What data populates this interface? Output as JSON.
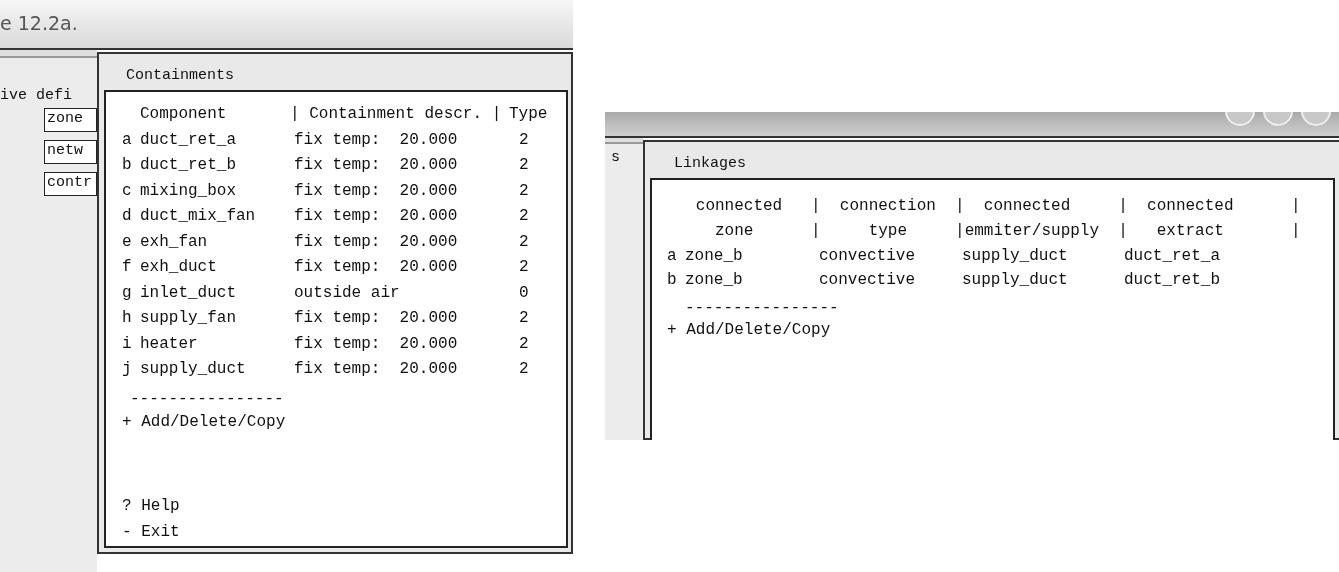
{
  "left_window": {
    "title": "e 12.2a.",
    "behind": {
      "label": "ive defi",
      "buttons": [
        "zone",
        "netw",
        "contr"
      ]
    },
    "dialog": {
      "title": "Containments",
      "columns": [
        "Component",
        "| Containment descr. |",
        "Type"
      ],
      "rows": [
        {
          "key": "a",
          "component": "duct_ret_a",
          "description": "fix temp:  20.000",
          "type": "2"
        },
        {
          "key": "b",
          "component": "duct_ret_b",
          "description": "fix temp:  20.000",
          "type": "2"
        },
        {
          "key": "c",
          "component": "mixing_box",
          "description": "fix temp:  20.000",
          "type": "2"
        },
        {
          "key": "d",
          "component": "duct_mix_fan",
          "description": "fix temp:  20.000",
          "type": "2"
        },
        {
          "key": "e",
          "component": "exh_fan",
          "description": "fix temp:  20.000",
          "type": "2"
        },
        {
          "key": "f",
          "component": "exh_duct",
          "description": "fix temp:  20.000",
          "type": "2"
        },
        {
          "key": "g",
          "component": "inlet_duct",
          "description": "outside air",
          "type": "0"
        },
        {
          "key": "h",
          "component": "supply_fan",
          "description": "fix temp:  20.000",
          "type": "2"
        },
        {
          "key": "i",
          "component": "heater",
          "description": "fix temp:  20.000",
          "type": "2"
        },
        {
          "key": "j",
          "component": "supply_duct",
          "description": "fix temp:  20.000",
          "type": "2"
        }
      ],
      "divider": "----------------",
      "menu": [
        "+ Add/Delete/Copy",
        "? Help",
        "- Exit"
      ]
    }
  },
  "right_window": {
    "behind": {
      "label": "s"
    },
    "dialog": {
      "title": "Linkages",
      "header_lines": [
        "   connected   |  connection  |  connected     |  connected      |",
        "     zone      |     type     |emmiter/supply  |   extract       |"
      ],
      "rows": [
        {
          "key": "a",
          "zone": "zone_b",
          "type": "convective",
          "emitter": "supply_duct",
          "extract": "duct_ret_a"
        },
        {
          "key": "b",
          "zone": "zone_b",
          "type": "convective",
          "emitter": "supply_duct",
          "extract": "duct_ret_b"
        }
      ],
      "divider": "----------------",
      "menu": [
        "+ Add/Delete/Copy"
      ]
    }
  }
}
